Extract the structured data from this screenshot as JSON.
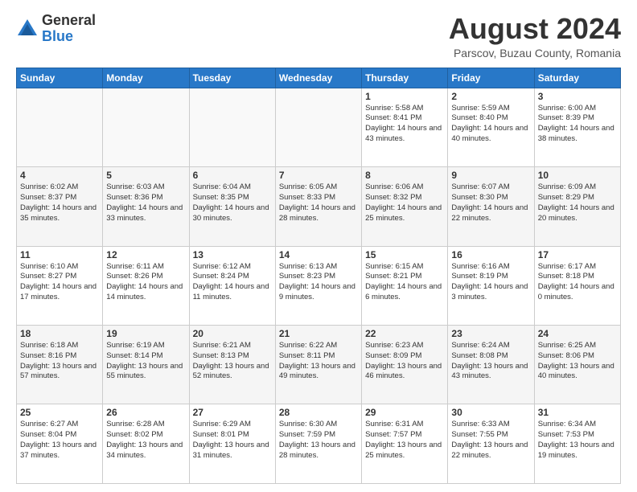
{
  "header": {
    "logo_general": "General",
    "logo_blue": "Blue",
    "month_year": "August 2024",
    "location": "Parscov, Buzau County, Romania"
  },
  "days_of_week": [
    "Sunday",
    "Monday",
    "Tuesday",
    "Wednesday",
    "Thursday",
    "Friday",
    "Saturday"
  ],
  "weeks": [
    [
      {
        "day": "",
        "text": ""
      },
      {
        "day": "",
        "text": ""
      },
      {
        "day": "",
        "text": ""
      },
      {
        "day": "",
        "text": ""
      },
      {
        "day": "1",
        "text": "Sunrise: 5:58 AM\nSunset: 8:41 PM\nDaylight: 14 hours and 43 minutes."
      },
      {
        "day": "2",
        "text": "Sunrise: 5:59 AM\nSunset: 8:40 PM\nDaylight: 14 hours and 40 minutes."
      },
      {
        "day": "3",
        "text": "Sunrise: 6:00 AM\nSunset: 8:39 PM\nDaylight: 14 hours and 38 minutes."
      }
    ],
    [
      {
        "day": "4",
        "text": "Sunrise: 6:02 AM\nSunset: 8:37 PM\nDaylight: 14 hours and 35 minutes."
      },
      {
        "day": "5",
        "text": "Sunrise: 6:03 AM\nSunset: 8:36 PM\nDaylight: 14 hours and 33 minutes."
      },
      {
        "day": "6",
        "text": "Sunrise: 6:04 AM\nSunset: 8:35 PM\nDaylight: 14 hours and 30 minutes."
      },
      {
        "day": "7",
        "text": "Sunrise: 6:05 AM\nSunset: 8:33 PM\nDaylight: 14 hours and 28 minutes."
      },
      {
        "day": "8",
        "text": "Sunrise: 6:06 AM\nSunset: 8:32 PM\nDaylight: 14 hours and 25 minutes."
      },
      {
        "day": "9",
        "text": "Sunrise: 6:07 AM\nSunset: 8:30 PM\nDaylight: 14 hours and 22 minutes."
      },
      {
        "day": "10",
        "text": "Sunrise: 6:09 AM\nSunset: 8:29 PM\nDaylight: 14 hours and 20 minutes."
      }
    ],
    [
      {
        "day": "11",
        "text": "Sunrise: 6:10 AM\nSunset: 8:27 PM\nDaylight: 14 hours and 17 minutes."
      },
      {
        "day": "12",
        "text": "Sunrise: 6:11 AM\nSunset: 8:26 PM\nDaylight: 14 hours and 14 minutes."
      },
      {
        "day": "13",
        "text": "Sunrise: 6:12 AM\nSunset: 8:24 PM\nDaylight: 14 hours and 11 minutes."
      },
      {
        "day": "14",
        "text": "Sunrise: 6:13 AM\nSunset: 8:23 PM\nDaylight: 14 hours and 9 minutes."
      },
      {
        "day": "15",
        "text": "Sunrise: 6:15 AM\nSunset: 8:21 PM\nDaylight: 14 hours and 6 minutes."
      },
      {
        "day": "16",
        "text": "Sunrise: 6:16 AM\nSunset: 8:19 PM\nDaylight: 14 hours and 3 minutes."
      },
      {
        "day": "17",
        "text": "Sunrise: 6:17 AM\nSunset: 8:18 PM\nDaylight: 14 hours and 0 minutes."
      }
    ],
    [
      {
        "day": "18",
        "text": "Sunrise: 6:18 AM\nSunset: 8:16 PM\nDaylight: 13 hours and 57 minutes."
      },
      {
        "day": "19",
        "text": "Sunrise: 6:19 AM\nSunset: 8:14 PM\nDaylight: 13 hours and 55 minutes."
      },
      {
        "day": "20",
        "text": "Sunrise: 6:21 AM\nSunset: 8:13 PM\nDaylight: 13 hours and 52 minutes."
      },
      {
        "day": "21",
        "text": "Sunrise: 6:22 AM\nSunset: 8:11 PM\nDaylight: 13 hours and 49 minutes."
      },
      {
        "day": "22",
        "text": "Sunrise: 6:23 AM\nSunset: 8:09 PM\nDaylight: 13 hours and 46 minutes."
      },
      {
        "day": "23",
        "text": "Sunrise: 6:24 AM\nSunset: 8:08 PM\nDaylight: 13 hours and 43 minutes."
      },
      {
        "day": "24",
        "text": "Sunrise: 6:25 AM\nSunset: 8:06 PM\nDaylight: 13 hours and 40 minutes."
      }
    ],
    [
      {
        "day": "25",
        "text": "Sunrise: 6:27 AM\nSunset: 8:04 PM\nDaylight: 13 hours and 37 minutes."
      },
      {
        "day": "26",
        "text": "Sunrise: 6:28 AM\nSunset: 8:02 PM\nDaylight: 13 hours and 34 minutes."
      },
      {
        "day": "27",
        "text": "Sunrise: 6:29 AM\nSunset: 8:01 PM\nDaylight: 13 hours and 31 minutes."
      },
      {
        "day": "28",
        "text": "Sunrise: 6:30 AM\nSunset: 7:59 PM\nDaylight: 13 hours and 28 minutes."
      },
      {
        "day": "29",
        "text": "Sunrise: 6:31 AM\nSunset: 7:57 PM\nDaylight: 13 hours and 25 minutes."
      },
      {
        "day": "30",
        "text": "Sunrise: 6:33 AM\nSunset: 7:55 PM\nDaylight: 13 hours and 22 minutes."
      },
      {
        "day": "31",
        "text": "Sunrise: 6:34 AM\nSunset: 7:53 PM\nDaylight: 13 hours and 19 minutes."
      }
    ]
  ]
}
